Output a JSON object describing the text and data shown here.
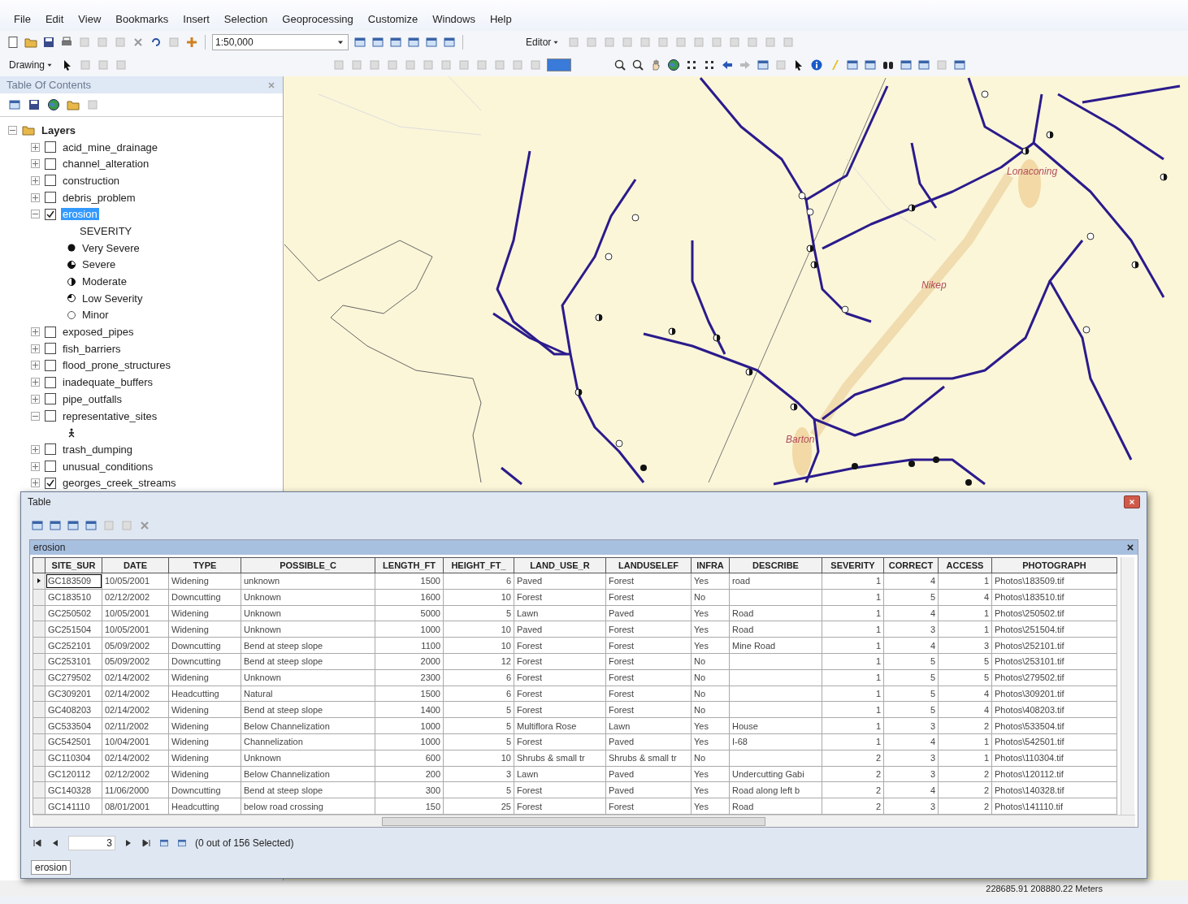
{
  "menu": [
    "File",
    "Edit",
    "View",
    "Bookmarks",
    "Insert",
    "Selection",
    "Geoprocessing",
    "Customize",
    "Windows",
    "Help"
  ],
  "toolbar": {
    "scale": "1:50,000",
    "editor_menu": "Editor",
    "drawing_menu": "Drawing"
  },
  "toc": {
    "title": "Table Of Contents",
    "tree": [
      {
        "label": "Layers",
        "expanded": true,
        "children": [
          {
            "label": "acid_mine_drainage",
            "checked": false,
            "expanded": false,
            "selected": false
          },
          {
            "label": "channel_alteration",
            "checked": false,
            "expanded": false,
            "selected": false
          },
          {
            "label": "construction",
            "checked": false,
            "expanded": false,
            "selected": false
          },
          {
            "label": "debris_problem",
            "checked": false,
            "expanded": false,
            "selected": false
          },
          {
            "label": "erosion",
            "checked": true,
            "expanded": true,
            "selected": true,
            "legend": {
              "heading": "SEVERITY",
              "classes": [
                {
                  "label": "Very Severe",
                  "kind": "full"
                },
                {
                  "label": "Severe",
                  "kind": "three-quarter"
                },
                {
                  "label": "Moderate",
                  "kind": "half"
                },
                {
                  "label": "Low Severity",
                  "kind": "quarter"
                },
                {
                  "label": "Minor",
                  "kind": "empty"
                }
              ]
            }
          },
          {
            "label": "exposed_pipes",
            "checked": false,
            "expanded": false,
            "selected": false
          },
          {
            "label": "fish_barriers",
            "checked": false,
            "expanded": false,
            "selected": false
          },
          {
            "label": "flood_prone_structures",
            "checked": false,
            "expanded": false,
            "selected": false
          },
          {
            "label": "inadequate_buffers",
            "checked": false,
            "expanded": false,
            "selected": false
          },
          {
            "label": "pipe_outfalls",
            "checked": false,
            "expanded": false,
            "selected": false
          },
          {
            "label": "representative_sites",
            "checked": false,
            "expanded": true,
            "selected": false,
            "legend": {
              "classes": [
                {
                  "kind": "figure"
                }
              ]
            }
          },
          {
            "label": "trash_dumping",
            "checked": false,
            "expanded": false,
            "selected": false
          },
          {
            "label": "unusual_conditions",
            "checked": false,
            "expanded": false,
            "selected": false
          },
          {
            "label": "georges_creek_streams",
            "checked": true,
            "expanded": false,
            "selected": false
          }
        ]
      }
    ]
  },
  "map": {
    "labels": [
      {
        "text": "Lonaconing"
      },
      {
        "text": "Nikep"
      },
      {
        "text": "Barton"
      }
    ]
  },
  "table_window": {
    "title": "Table",
    "layer_tab": "erosion",
    "columns": [
      {
        "name": "SITE_SUR"
      },
      {
        "name": "DATE"
      },
      {
        "name": "TYPE"
      },
      {
        "name": "POSSIBLE_C"
      },
      {
        "name": "LENGTH_FT"
      },
      {
        "name": "HEIGHT_FT_"
      },
      {
        "name": "LAND_USE_R"
      },
      {
        "name": "LANDUSELEF"
      },
      {
        "name": "INFRA"
      },
      {
        "name": "DESCRIBE"
      },
      {
        "name": "SEVERITY"
      },
      {
        "name": "CORRECT"
      },
      {
        "name": "ACCESS"
      },
      {
        "name": "PHOTOGRAPH"
      }
    ],
    "rows": [
      {
        "current": true,
        "cells": [
          "GC183509",
          "10/05/2001",
          "Widening",
          "unknown",
          "1500",
          "6",
          "Paved",
          "Forest",
          "Yes",
          "road",
          "1",
          "4",
          "1",
          "Photos\\183509.tif"
        ]
      },
      {
        "current": false,
        "cells": [
          "GC183510",
          "02/12/2002",
          "Downcutting",
          "Unknown",
          "1600",
          "10",
          "Forest",
          "Forest",
          "No",
          null,
          "1",
          "5",
          "4",
          "Photos\\183510.tif"
        ]
      },
      {
        "current": false,
        "cells": [
          "GC250502",
          "10/05/2001",
          "Widening",
          "Unknown",
          "5000",
          "5",
          "Lawn",
          "Paved",
          "Yes",
          "Road",
          "1",
          "4",
          "1",
          "Photos\\250502.tif"
        ]
      },
      {
        "current": false,
        "cells": [
          "GC251504",
          "10/05/2001",
          "Widening",
          "Unknown",
          "1000",
          "10",
          "Paved",
          "Forest",
          "Yes",
          "Road",
          "1",
          "3",
          "1",
          "Photos\\251504.tif"
        ]
      },
      {
        "current": false,
        "cells": [
          "GC252101",
          "05/09/2002",
          "Downcutting",
          "Bend at steep slope",
          "1100",
          "10",
          "Forest",
          "Forest",
          "Yes",
          "Mine Road",
          "1",
          "4",
          "3",
          "Photos\\252101.tif"
        ]
      },
      {
        "current": false,
        "cells": [
          "GC253101",
          "05/09/2002",
          "Downcutting",
          "Bend at steep slope",
          "2000",
          "12",
          "Forest",
          "Forest",
          "No",
          null,
          "1",
          "5",
          "5",
          "Photos\\253101.tif"
        ]
      },
      {
        "current": false,
        "cells": [
          "GC279502",
          "02/14/2002",
          "Widening",
          "Unknown",
          "2300",
          "6",
          "Forest",
          "Forest",
          "No",
          null,
          "1",
          "5",
          "5",
          "Photos\\279502.tif"
        ]
      },
      {
        "current": false,
        "cells": [
          "GC309201",
          "02/14/2002",
          "Headcutting",
          "Natural",
          "1500",
          "6",
          "Forest",
          "Forest",
          "No",
          null,
          "1",
          "5",
          "4",
          "Photos\\309201.tif"
        ]
      },
      {
        "current": false,
        "cells": [
          "GC408203",
          "02/14/2002",
          "Widening",
          "Bend at steep slope",
          "1400",
          "5",
          "Forest",
          "Forest",
          "No",
          null,
          "1",
          "5",
          "4",
          "Photos\\408203.tif"
        ]
      },
      {
        "current": false,
        "cells": [
          "GC533504",
          "02/11/2002",
          "Widening",
          "Below Channelization",
          "1000",
          "5",
          "Multiflora Rose",
          "Lawn",
          "Yes",
          "House",
          "1",
          "3",
          "2",
          "Photos\\533504.tif"
        ]
      },
      {
        "current": false,
        "cells": [
          "GC542501",
          "10/04/2001",
          "Widening",
          "Channelization",
          "1000",
          "5",
          "Forest",
          "Paved",
          "Yes",
          "I-68",
          "1",
          "4",
          "1",
          "Photos\\542501.tif"
        ]
      },
      {
        "current": false,
        "cells": [
          "GC110304",
          "02/14/2002",
          "Widening",
          "Unknown",
          "600",
          "10",
          "Shrubs & small tr",
          "Shrubs & small tr",
          "No",
          null,
          "2",
          "3",
          "1",
          "Photos\\110304.tif"
        ]
      },
      {
        "current": false,
        "cells": [
          "GC120112",
          "02/12/2002",
          "Widening",
          "Below Channelization",
          "200",
          "3",
          "Lawn",
          "Paved",
          "Yes",
          "Undercutting Gabi",
          "2",
          "3",
          "2",
          "Photos\\120112.tif"
        ]
      },
      {
        "current": false,
        "cells": [
          "GC140328",
          "11/06/2000",
          "Downcutting",
          "Bend at steep slope",
          "300",
          "5",
          "Forest",
          "Paved",
          "Yes",
          "Road along left b",
          "2",
          "4",
          "2",
          "Photos\\140328.tif"
        ]
      },
      {
        "current": false,
        "cells": [
          "GC141110",
          "08/01/2001",
          "Headcutting",
          "below road crossing",
          "150",
          "25",
          "Forest",
          "Forest",
          "Yes",
          "Road",
          "2",
          "3",
          "2",
          "Photos\\141110.tif"
        ]
      }
    ],
    "record": "3",
    "selection_status": "(0 out of 156 Selected)",
    "bottom_tab": "erosion"
  },
  "status_bar": {
    "coordinates": "228685.91  208880.22 Meters"
  }
}
